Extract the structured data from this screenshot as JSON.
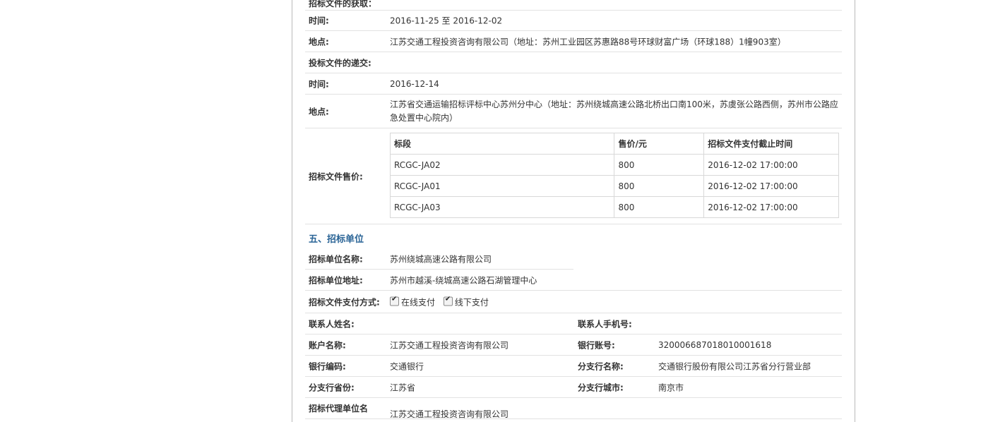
{
  "top_cut_label": "招标文件的获取：",
  "doc_get": {
    "time_label": "时间:",
    "time_value": "2016-11-25 至 2016-12-02",
    "place_label": "地点:",
    "place_value": "江苏交通工程投资咨询有限公司（地址：苏州工业园区苏惠路88号环球财富广场（环球188）1幢903室）"
  },
  "doc_submit": {
    "heading": "投标文件的递交:",
    "time_label": "时间:",
    "time_value": "2016-12-14",
    "place_label": "地点:",
    "place_value": "江苏省交通运输招标评标中心苏州分中心（地址：苏州绕城高速公路北桥出口南100米，苏虞张公路西侧，苏州市公路应急处置中心院内）"
  },
  "price": {
    "label": "招标文件售价:",
    "headers": [
      "标段",
      "售价/元",
      "招标文件支付截止时间"
    ],
    "rows": [
      [
        "RCGC-JA02",
        "800",
        "2016-12-02 17:00:00"
      ],
      [
        "RCGC-JA01",
        "800",
        "2016-12-02 17:00:00"
      ],
      [
        "RCGC-JA03",
        "800",
        "2016-12-02 17:00:00"
      ]
    ]
  },
  "section5": {
    "title": "五、招标单位",
    "name_label": "招标单位名称:",
    "name_value": "苏州绕城高速公路有限公司",
    "addr_label": "招标单位地址:",
    "addr_value": "苏州市越溪-绕城高速公路石湖管理中心",
    "pay_label": "招标文件支付方式:",
    "pay_online": "在线支付",
    "pay_offline": "线下支付",
    "contact_label": "联系人姓名:",
    "contact_value": "",
    "phone_label": "联系人手机号:",
    "phone_value": "",
    "account_name_label": "账户名称:",
    "account_name_value": "江苏交通工程投资咨询有限公司",
    "bank_account_label": "银行账号:",
    "bank_account_value": "320006687018010001618",
    "bank_code_label": "银行编码:",
    "bank_code_value": "交通银行",
    "branch_name_label": "分支行名称:",
    "branch_name_value": "交通银行股份有限公司江苏省分行营业部",
    "branch_province_label": "分支行省份:",
    "branch_province_value": "江苏省",
    "branch_city_label": "分支行城市:",
    "branch_city_value": "南京市",
    "agent_label": "招标代理单位名",
    "agent_value": "江苏交通工程投资咨询有限公司"
  }
}
